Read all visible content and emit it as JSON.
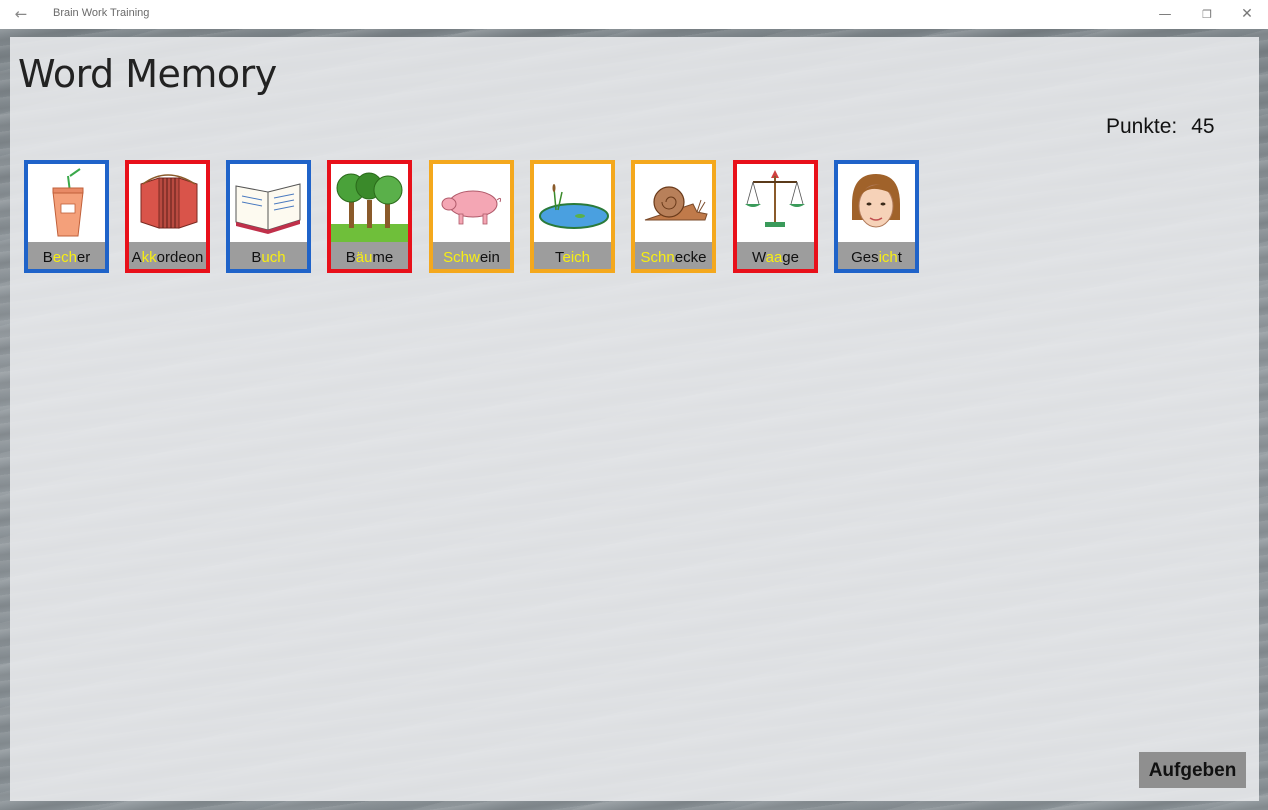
{
  "window": {
    "app_title": "Brain Work Training",
    "back_icon": "back-arrow-icon",
    "minimize_icon": "minimize-icon",
    "maximize_icon": "restore-icon",
    "close_icon": "close-icon"
  },
  "page": {
    "title": "Word Memory",
    "score_label": "Punkte:",
    "score_value": "45"
  },
  "cards": [
    {
      "word_parts": [
        "B",
        "ech",
        "er"
      ],
      "word": "Becher",
      "image": "cup-icon",
      "border_color": "#1f63c9"
    },
    {
      "word_parts": [
        "A",
        "kk",
        "ordeon"
      ],
      "word": "Akkordeon",
      "image": "accordion-icon",
      "border_color": "#e8101a"
    },
    {
      "word_parts": [
        "B",
        "uch",
        ""
      ],
      "word": "Buch",
      "image": "book-icon",
      "border_color": "#1f63c9"
    },
    {
      "word_parts": [
        "B",
        "äu",
        "me"
      ],
      "word": "Bäume",
      "image": "trees-icon",
      "border_color": "#e8101a"
    },
    {
      "word_parts": [
        "",
        "Schw",
        "ein"
      ],
      "word": "Schwein",
      "image": "pig-icon",
      "border_color": "#f4a81d"
    },
    {
      "word_parts": [
        "T",
        "eich",
        ""
      ],
      "word": "Teich",
      "image": "pond-icon",
      "border_color": "#f4a81d"
    },
    {
      "word_parts": [
        "",
        "Schn",
        "ecke"
      ],
      "word": "Schnecke",
      "image": "snail-icon",
      "border_color": "#f4a81d"
    },
    {
      "word_parts": [
        "W",
        "aa",
        "ge"
      ],
      "word": "Waage",
      "image": "scale-icon",
      "border_color": "#e8101a"
    },
    {
      "word_parts": [
        "Ges",
        "ich",
        "t"
      ],
      "word": "Gesicht",
      "image": "face-icon",
      "border_color": "#1f63c9"
    }
  ],
  "highlight_color": "#f7ee12",
  "actions": {
    "give_up_label": "Aufgeben"
  }
}
